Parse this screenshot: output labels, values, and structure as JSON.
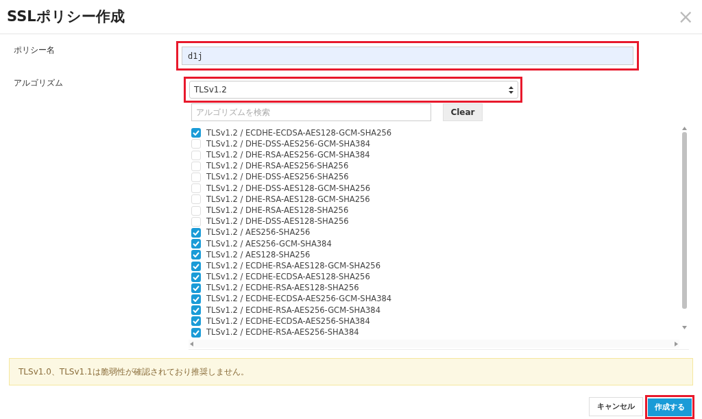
{
  "dialog": {
    "title": "SSLポリシー作成",
    "close": "×"
  },
  "fields": {
    "name_label": "ポリシー名",
    "name_value": "d1j",
    "algorithm_label": "アルゴリズム",
    "algorithm_value": "TLSv1.2",
    "search_placeholder": "アルゴリズムを検索",
    "clear_button": "Clear"
  },
  "ciphers": [
    {
      "label": "TLSv1.2 / ECDHE-ECDSA-AES128-GCM-SHA256",
      "checked": true
    },
    {
      "label": "TLSv1.2 / DHE-DSS-AES256-GCM-SHA384",
      "checked": false
    },
    {
      "label": "TLSv1.2 / DHE-RSA-AES256-GCM-SHA384",
      "checked": false
    },
    {
      "label": "TLSv1.2 / DHE-RSA-AES256-SHA256",
      "checked": false
    },
    {
      "label": "TLSv1.2 / DHE-DSS-AES256-SHA256",
      "checked": false
    },
    {
      "label": "TLSv1.2 / DHE-DSS-AES128-GCM-SHA256",
      "checked": false
    },
    {
      "label": "TLSv1.2 / DHE-RSA-AES128-GCM-SHA256",
      "checked": false
    },
    {
      "label": "TLSv1.2 / DHE-RSA-AES128-SHA256",
      "checked": false
    },
    {
      "label": "TLSv1.2 / DHE-DSS-AES128-SHA256",
      "checked": false
    },
    {
      "label": "TLSv1.2 / AES256-SHA256",
      "checked": true
    },
    {
      "label": "TLSv1.2 / AES256-GCM-SHA384",
      "checked": true
    },
    {
      "label": "TLSv1.2 / AES128-SHA256",
      "checked": true
    },
    {
      "label": "TLSv1.2 / ECDHE-RSA-AES128-GCM-SHA256",
      "checked": true
    },
    {
      "label": "TLSv1.2 / ECDHE-ECDSA-AES128-SHA256",
      "checked": true
    },
    {
      "label": "TLSv1.2 / ECDHE-RSA-AES128-SHA256",
      "checked": true
    },
    {
      "label": "TLSv1.2 / ECDHE-ECDSA-AES256-GCM-SHA384",
      "checked": true
    },
    {
      "label": "TLSv1.2 / ECDHE-RSA-AES256-GCM-SHA384",
      "checked": true
    },
    {
      "label": "TLSv1.2 / ECDHE-ECDSA-AES256-SHA384",
      "checked": true
    },
    {
      "label": "TLSv1.2 / ECDHE-RSA-AES256-SHA384",
      "checked": true
    }
  ],
  "warning": "TLSv1.0、TLSv1.1は脆弱性が確認されており推奨しません。",
  "buttons": [
    {
      "label": "キャンセル",
      "kind": "secondary"
    },
    {
      "label": "作成する",
      "kind": "primary"
    }
  ]
}
